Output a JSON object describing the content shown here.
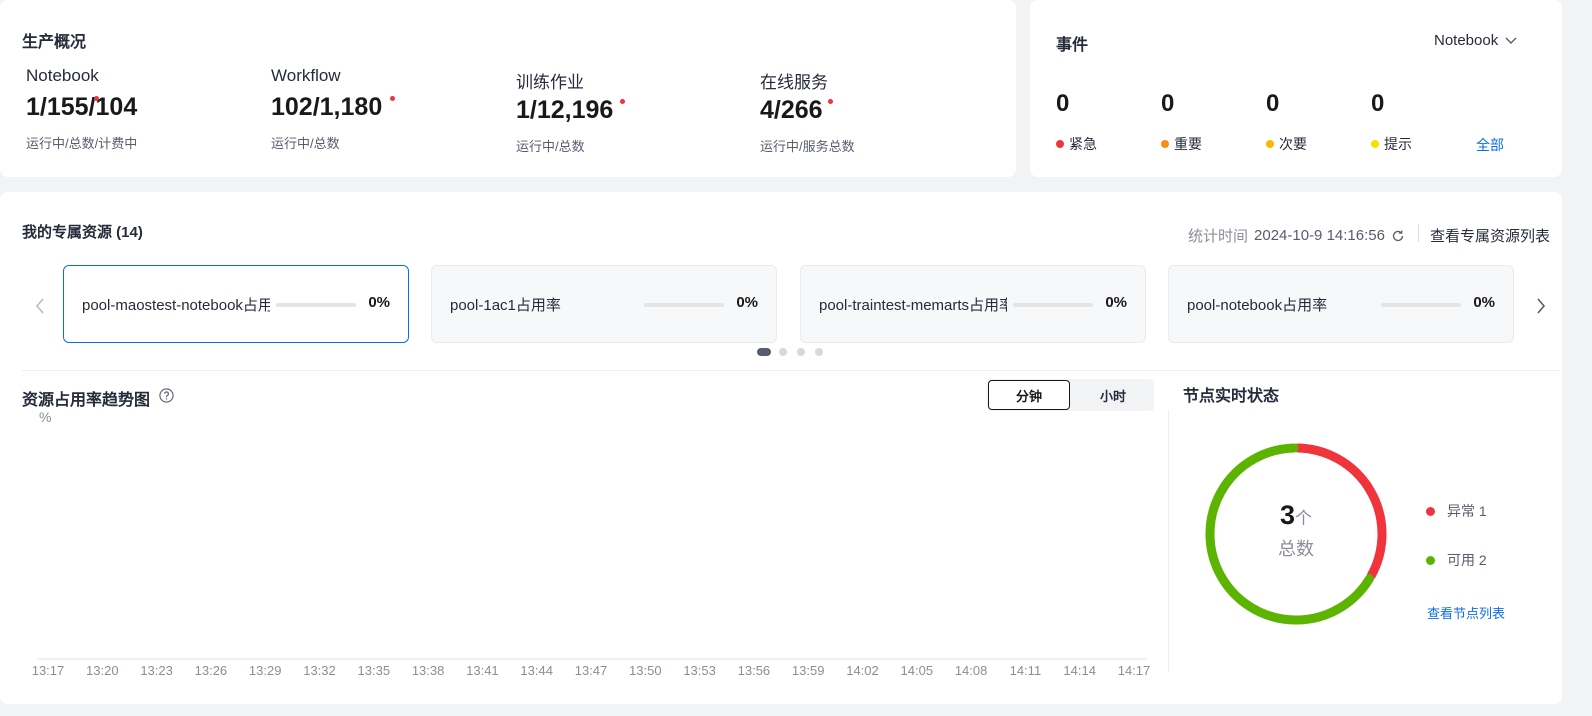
{
  "overview": {
    "title": "生产概况",
    "stats": [
      {
        "label": "Notebook",
        "value": "1/155/104",
        "sub": "运行中/总数/计费中"
      },
      {
        "label": "Workflow",
        "value": "102/1,180",
        "sub": "运行中/总数"
      },
      {
        "label": "训练作业",
        "value": "1/12,196",
        "sub": "运行中/总数"
      },
      {
        "label": "在线服务",
        "value": "4/266",
        "sub": "运行中/服务总数"
      }
    ]
  },
  "events": {
    "title": "事件",
    "filter": "Notebook",
    "items": [
      {
        "count": "0",
        "label": "紧急",
        "color": "#f0343b"
      },
      {
        "count": "0",
        "label": "重要",
        "color": "#fa8c16"
      },
      {
        "count": "0",
        "label": "次要",
        "color": "#fab900"
      },
      {
        "count": "0",
        "label": "提示",
        "color": "#f5e100"
      }
    ],
    "all_link": "全部"
  },
  "resources": {
    "title": "我的专属资源 (14)",
    "stat_time_label": "统计时间",
    "stat_time": "2024-10-9 14:16:56",
    "list_link": "查看专属资源列表",
    "pools": [
      {
        "name": "pool-maostest-notebook占用率",
        "pct": "0%",
        "usage": 0
      },
      {
        "name": "pool-1ac1占用率",
        "pct": "0%",
        "usage": 0
      },
      {
        "name": "pool-traintest-memarts占用率",
        "pct": "0%",
        "usage": 0
      },
      {
        "name": "pool-notebook占用率",
        "pct": "0%",
        "usage": 0
      }
    ]
  },
  "trend": {
    "title": "资源占用率趋势图",
    "tab_minute": "分钟",
    "tab_hour": "小时",
    "unit": "%"
  },
  "chart_data": {
    "type": "line",
    "title": "资源占用率趋势图",
    "ylabel": "%",
    "x": [
      "13:17",
      "13:20",
      "13:23",
      "13:26",
      "13:29",
      "13:32",
      "13:35",
      "13:38",
      "13:41",
      "13:44",
      "13:47",
      "13:50",
      "13:53",
      "13:56",
      "13:59",
      "14:02",
      "14:05",
      "14:08",
      "14:11",
      "14:14",
      "14:17"
    ],
    "series": []
  },
  "nodes": {
    "title": "节点实时状态",
    "total": "3",
    "total_unit": "个",
    "total_label": "总数",
    "legend": [
      {
        "label": "异常",
        "count": "1",
        "color": "#f0343b",
        "value": 1
      },
      {
        "label": "可用",
        "count": "2",
        "color": "#5cb300",
        "value": 2
      }
    ],
    "list_link": "查看节点列表"
  }
}
